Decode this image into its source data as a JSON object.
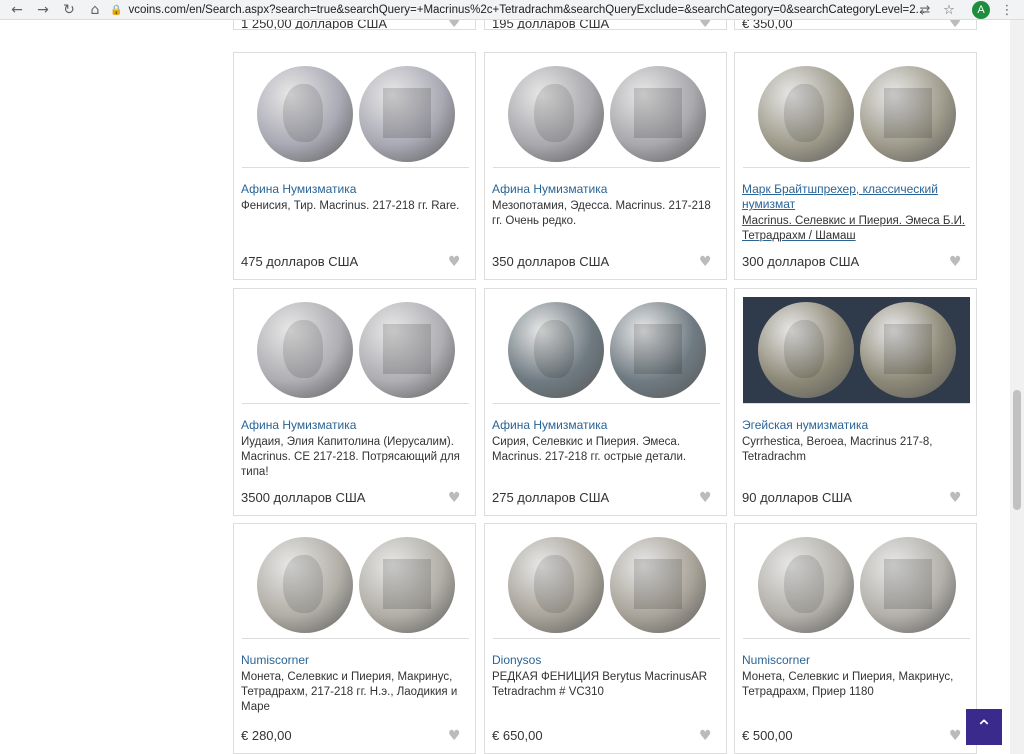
{
  "browser": {
    "url": "vcoins.com/en/Search.aspx?search=true&searchQuery=+Macrinus%2c+Tetradrachm&searchQueryExclude=&searchCategory=0&searchCategoryLevel=2...",
    "avatar": "A"
  },
  "top_prices": [
    "1 250,00 долларов США",
    "195 долларов США",
    "€ 350,00"
  ],
  "cards": [
    {
      "seller": "Афина Нумизматика",
      "desc": "Фенисия, Тир. Macrinus. 217-218 гг. Rare.",
      "price": "475 долларов США",
      "coin_color": "#a9a9b4"
    },
    {
      "seller": "Афина Нумизматика",
      "desc": "Мезопотамия, Эдесса. Macrinus. 217-218 гг. Очень редко.",
      "price": "350 долларов США",
      "coin_color": "#a8a8ad"
    },
    {
      "seller": "Марк Брайтшпрехер, классический нумизмат",
      "desc": "Macrinus. Селевкис и Пиерия. Эмеса Б.И. Тетрадрахм / Шамаш",
      "price": "300 долларов США",
      "coin_color": "#9f9c8c"
    },
    {
      "seller": "Афина Нумизматика",
      "desc": "Иудаия, Элия Капитолина (Иерусалим). Macrinus. CE 217-218. Потрясающий для типа!",
      "price": "3500 долларов США",
      "coin_color": "#aeaeb3"
    },
    {
      "seller": "Афина Нумизматика",
      "desc": "Сирия, Селевкис и Пиерия. Эмеса. Macrinus. 217-218 гг. острые детали.",
      "price": "275 долларов США",
      "coin_color": "#6f7b82"
    },
    {
      "seller": "Эгейская нумизматика",
      "desc": "Cyrrhestica, Beroea, Macrinus 217-8, Tetradrachm",
      "price": "90 долларов США",
      "coin_color": "#8e8a78"
    },
    {
      "seller": "Numiscorner",
      "desc": "Монета, Селевкис и Пиерия, Макринус, Тетрадрахм, 217-218 гг. Н.э., Лаодикия и Маре",
      "price": "€ 280,00",
      "coin_color": "#b1aea6"
    },
    {
      "seller": "Dionysos",
      "desc": "РЕДКАЯ ФЕНИЦИЯ Berytus MacrinusAR Tetradrachm # VC310",
      "price": "€ 650,00",
      "coin_color": "#a9a49a"
    },
    {
      "seller": "Numiscorner",
      "desc": "Монета, Селевкис и Пиерия, Макринус, Тетрадрахм, Приер 1180",
      "price": "€ 500,00",
      "coin_color": "#b3b0aa"
    }
  ]
}
